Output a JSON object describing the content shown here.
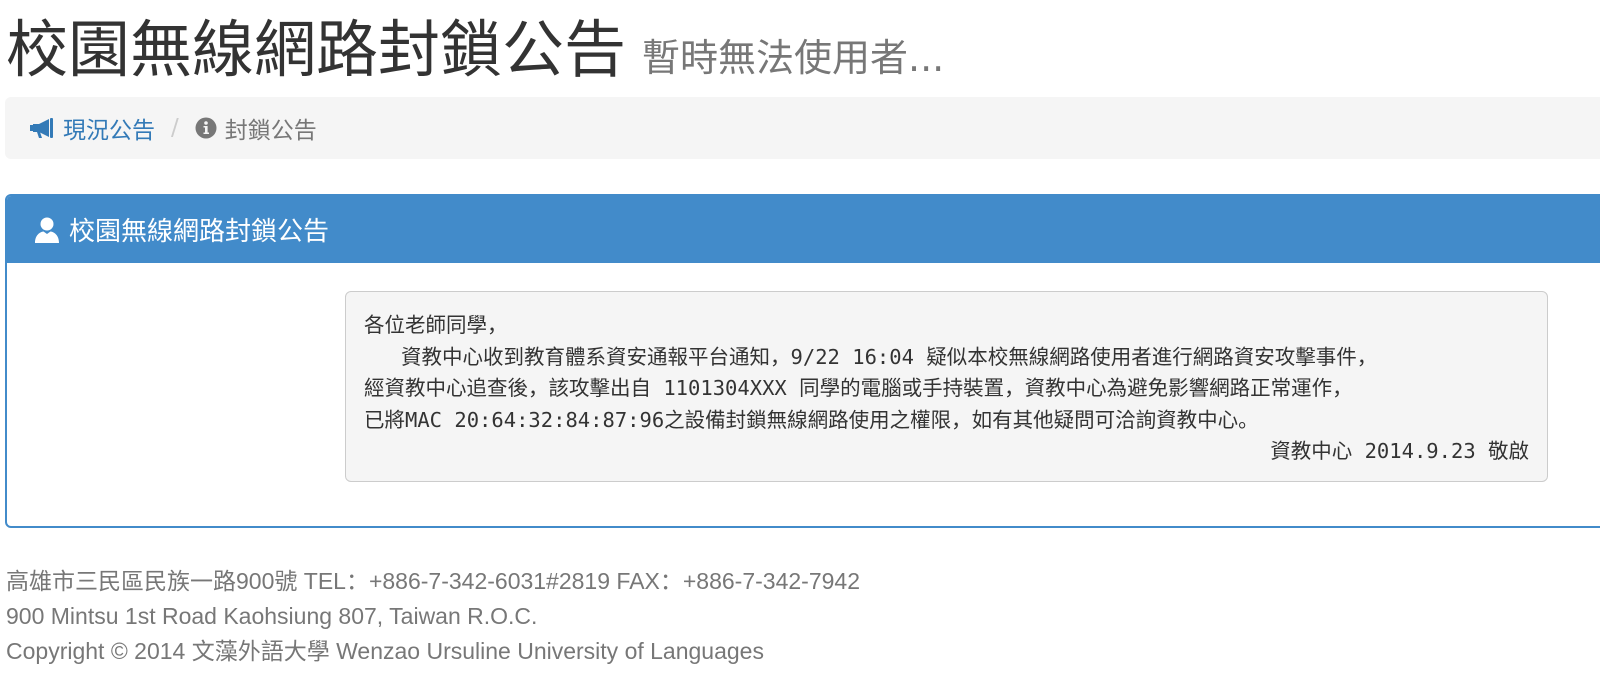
{
  "header": {
    "title": "校園無線網路封鎖公告",
    "subtitle": "暫時無法使用者..."
  },
  "breadcrumb": {
    "items": [
      {
        "label": "現況公告",
        "icon": "megaphone-icon"
      },
      {
        "label": "封鎖公告",
        "icon": "info-circle-icon"
      }
    ],
    "separator": "/"
  },
  "panel": {
    "title": "校園無線網路封鎖公告",
    "icon": "user-icon",
    "notice": {
      "lines": [
        "各位老師同學，",
        "   資教中心收到教育體系資安通報平台通知，9/22 16:04 疑似本校無線網路使用者進行網路資安攻擊事件，",
        "經資教中心追查後，該攻擊出自 1101304XXX 同學的電腦或手持裝置，資教中心為避免影響網路正常運作，",
        "已將MAC 20:64:32:84:87:96之設備封鎖無線網路使用之權限，如有其他疑問可洽詢資教中心。"
      ],
      "signature": "資教中心 2014.9.23 敬啟"
    }
  },
  "footer": {
    "address_zh": "高雄市三民區民族一路900號 TEL：+886-7-342-6031#2819 FAX：+886-7-342-7942",
    "address_en": "900 Mintsu 1st Road Kaohsiung 807, Taiwan R.O.C.",
    "copyright": "Copyright © 2014 文藻外語大學 Wenzao Ursuline University of Languages"
  },
  "colors": {
    "primary": "#428bca",
    "link": "#337ab7",
    "muted": "#777777",
    "well": "#f5f5f5"
  }
}
